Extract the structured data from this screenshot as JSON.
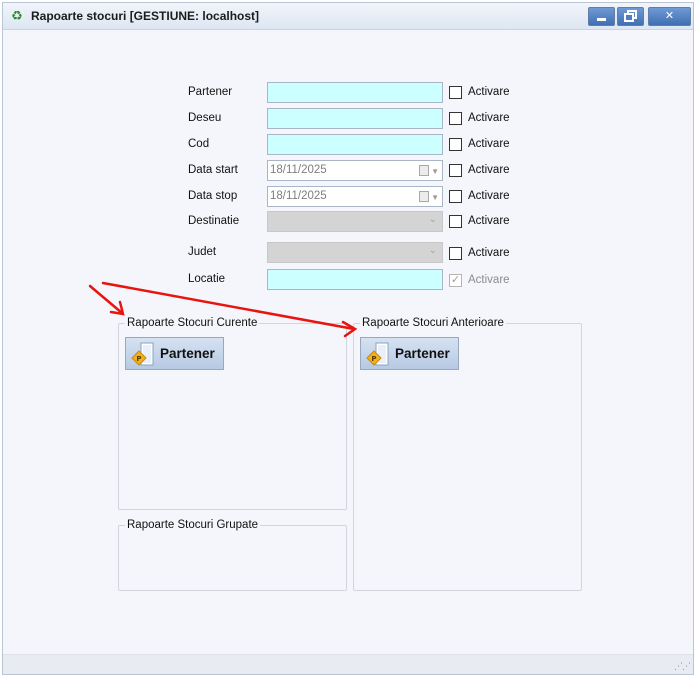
{
  "window": {
    "title": "Rapoarte stocuri [GESTIUNE: localhost]",
    "app_icon": "recycle-icon",
    "controls": {
      "minimize": "minimize-icon",
      "maximize": "restore-icon",
      "close_glyph": "✕"
    }
  },
  "filters": [
    {
      "key": "partener",
      "label": "Partener",
      "type": "text",
      "value": "",
      "activare_label": "Activare",
      "activare_checked": false
    },
    {
      "key": "deseu",
      "label": "Deseu",
      "type": "text",
      "value": "",
      "activare_label": "Activare",
      "activare_checked": false
    },
    {
      "key": "cod",
      "label": "Cod",
      "type": "text",
      "value": "",
      "activare_label": "Activare",
      "activare_checked": false
    },
    {
      "key": "data_start",
      "label": "Data start",
      "type": "date",
      "value": "18/11/2025",
      "activare_label": "Activare",
      "activare_checked": false
    },
    {
      "key": "data_stop",
      "label": "Data stop",
      "type": "date",
      "value": "18/11/2025",
      "activare_label": "Activare",
      "activare_checked": false
    },
    {
      "key": "destinatie",
      "label": "Destinatie",
      "type": "combo",
      "value": "",
      "activare_label": "Activare",
      "activare_checked": false
    },
    {
      "key": "judet",
      "label": "Judet",
      "type": "combo",
      "value": "",
      "activare_label": "Activare",
      "activare_checked": false
    },
    {
      "key": "locatie",
      "label": "Locatie",
      "type": "text",
      "value": "",
      "activare_label": "Activare",
      "activare_checked": true,
      "activare_disabled": true
    }
  ],
  "groups": {
    "curente": {
      "title": "Rapoarte Stocuri Curente",
      "button_label": "Partener"
    },
    "grupate": {
      "title": "Rapoarte Stocuri Grupate"
    },
    "anterioare": {
      "title": "Rapoarte Stocuri Anterioare",
      "button_label": "Partener"
    }
  },
  "annotations": {
    "arrow_color": "#e8140f"
  },
  "colors": {
    "text_field_bg": "#ccffff",
    "window_bg": "#f4f6fb"
  }
}
